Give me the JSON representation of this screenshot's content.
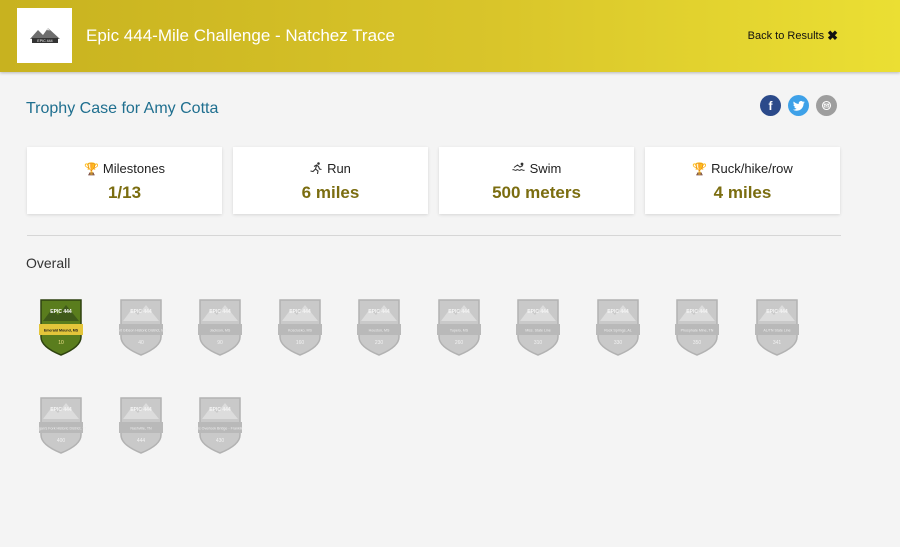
{
  "header": {
    "title": "Epic 444-Mile Challenge - Natchez Trace",
    "logo_text": "EPIC 444",
    "back_label": "Back to Results",
    "back_icon": "close-icon"
  },
  "page": {
    "heading": "Trophy Case for Amy Cotta"
  },
  "share": [
    {
      "name": "facebook",
      "glyph": "f",
      "color": "#2b4a8a"
    },
    {
      "name": "twitter",
      "glyph": "",
      "color": "#3ea1e8"
    },
    {
      "name": "email",
      "glyph": "",
      "color": "#9e9e9e"
    }
  ],
  "stats": [
    {
      "icon": "trophy-icon",
      "label": "Milestones",
      "value": "1/13"
    },
    {
      "icon": "runner-icon",
      "label": "Run",
      "value": "6 miles"
    },
    {
      "icon": "swimmer-icon",
      "label": "Swim",
      "value": "500 meters"
    },
    {
      "icon": "trophy-icon",
      "label": "Ruck/hike/row",
      "value": "4 miles"
    }
  ],
  "overall": {
    "title": "Overall",
    "badges": [
      {
        "earned": true,
        "place": "Emerald Mound, MS",
        "mile": "10"
      },
      {
        "earned": false,
        "place": "Port Gibson Historic District, MS",
        "mile": "40"
      },
      {
        "earned": false,
        "place": "Jackson, MS",
        "mile": "90"
      },
      {
        "earned": false,
        "place": "Kosciusko, MS",
        "mile": "160"
      },
      {
        "earned": false,
        "place": "Houston, MS",
        "mile": "230"
      },
      {
        "earned": false,
        "place": "Tupelo, MS",
        "mile": "260"
      },
      {
        "earned": false,
        "place": "Miss. State Line",
        "mile": "310"
      },
      {
        "earned": false,
        "place": "Rock Springs, AL",
        "mile": "330"
      },
      {
        "earned": false,
        "place": "Phosphate Mine, TN",
        "mile": "350"
      },
      {
        "earned": false,
        "place": "AL/TN State Line",
        "mile": "341"
      },
      {
        "earned": false,
        "place": "Logan's Fork Historic District, TN",
        "mile": "400"
      },
      {
        "earned": false,
        "place": "Nashville, TN",
        "mile": "444"
      },
      {
        "earned": false,
        "place": "Scenic Overlook Bridge - Franklin, TN",
        "mile": "430"
      }
    ]
  },
  "colors": {
    "header_start": "#c8b21f",
    "header_end": "#ebdf33",
    "heading": "#1f6f8f",
    "stat_value": "#7b6d10",
    "badge_earned": "#5a7d1d"
  }
}
